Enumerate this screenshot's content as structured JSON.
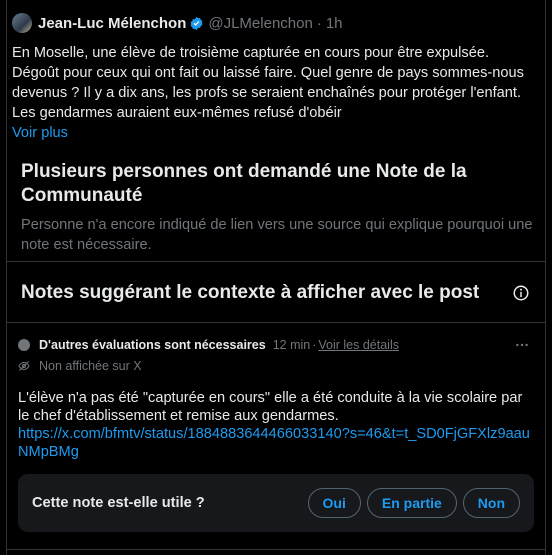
{
  "tweet": {
    "author_name": "Jean-Luc Mélenchon",
    "handle": "@JLMelenchon",
    "separator": "·",
    "time": "1h",
    "text": "En Moselle, une élève de troisième capturée en cours pour être expulsée. Dégoût pour ceux qui ont fait ou laissé faire. Quel genre de pays sommes-nous devenus ? Il y a dix ans, les profs se seraient enchaînés pour protéger l'enfant. Les gendarmes auraient eux-mêmes refusé d'obéir",
    "read_more": "Voir plus"
  },
  "request": {
    "title": "Plusieurs personnes ont demandé une Note de la Communauté",
    "description": "Personne n'a encore indiqué de lien vers une source qui explique pourquoi une note est nécessaire."
  },
  "notes_section": {
    "title": "Notes suggérant le contexte à afficher avec le post"
  },
  "note": {
    "status": "D'autres évaluations sont nécessaires",
    "time": "12 min",
    "separator": "·",
    "details_link": "Voir les détails",
    "visibility": "Non affichée sur X",
    "text": "L'élève n'a pas été \"capturée  en cours\" elle a été conduite à la vie scolaire par le chef d'établissement et remise aux gendarmes.",
    "link": "https://x.com/bfmtv/status/1884883644466033140?s=46&t=t_SD0FjGFXlz9aauNMpBMg"
  },
  "helpful": {
    "question": "Cette note est-elle utile ?",
    "options": [
      "Oui",
      "En partie",
      "Non"
    ]
  },
  "colors": {
    "background": "#000000",
    "text": "#e7e9ea",
    "muted": "#71767b",
    "accent": "#1d9bf0",
    "border": "#2f3336",
    "card": "#16181c"
  }
}
